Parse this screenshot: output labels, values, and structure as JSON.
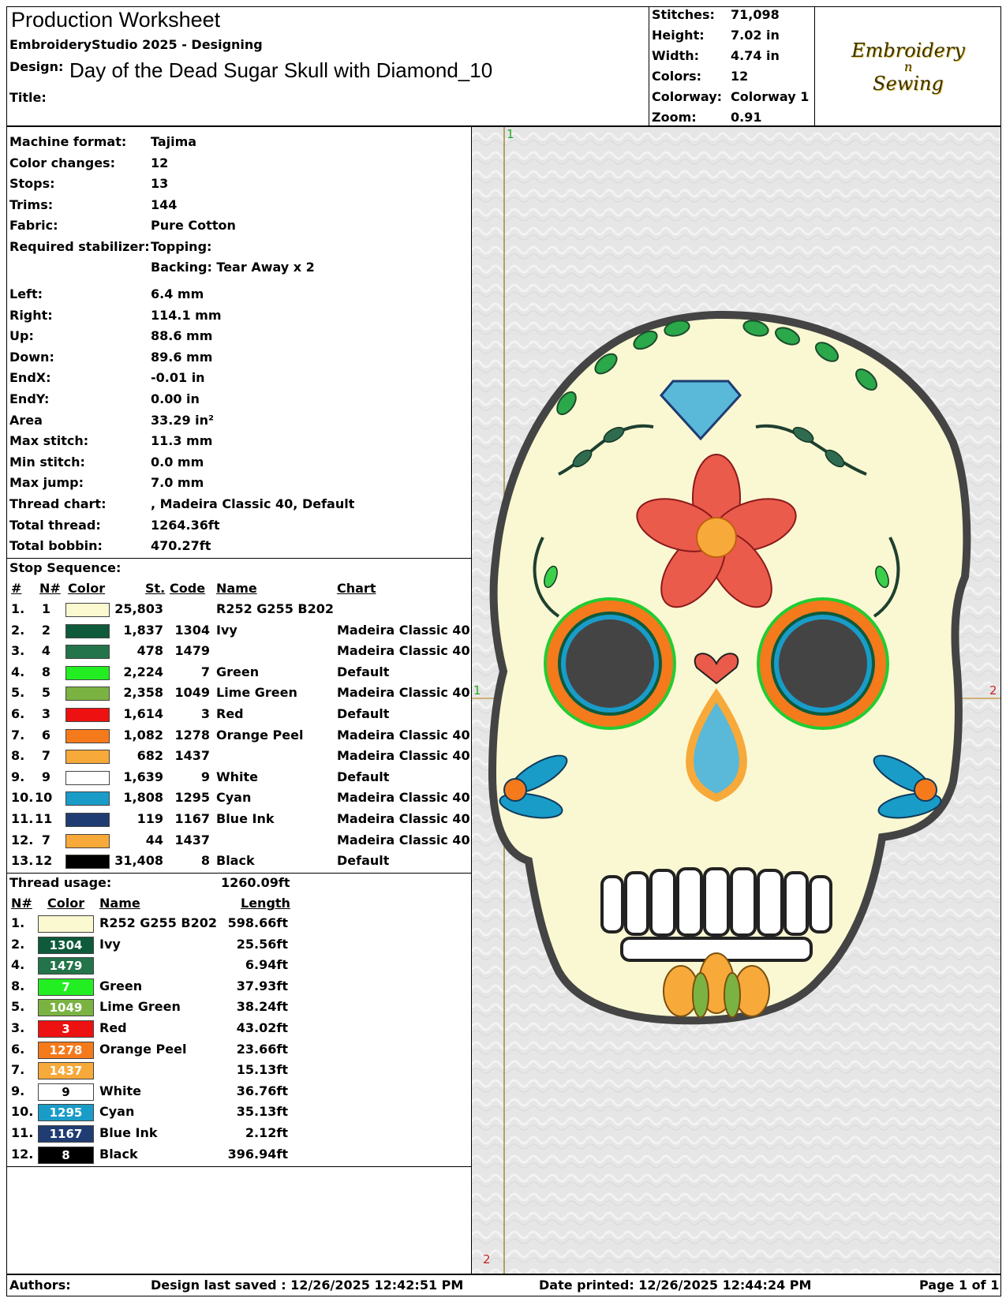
{
  "header": {
    "title": "Production Worksheet",
    "app": "EmbroideryStudio 2025 - Designing",
    "design_label": "Design:",
    "design_name": "Day of the Dead Sugar Skull with Diamond_10",
    "title_label": "Title:"
  },
  "stats": [
    {
      "label": "Stitches:",
      "value": "71,098"
    },
    {
      "label": "Height:",
      "value": "7.02 in"
    },
    {
      "label": "Width:",
      "value": "4.74 in"
    },
    {
      "label": "Colors:",
      "value": "12"
    },
    {
      "label": "Colorway:",
      "value": "Colorway 1"
    },
    {
      "label": "Zoom:",
      "value": "0.91"
    }
  ],
  "logo": {
    "line1": "Embroidery",
    "line2": "n",
    "line3": "Sewing"
  },
  "details": [
    {
      "label": "Machine format:",
      "value": "Tajima"
    },
    {
      "label": "Color changes:",
      "value": "12"
    },
    {
      "label": "Stops:",
      "value": "13"
    },
    {
      "label": "Trims:",
      "value": "144"
    },
    {
      "label": "Fabric:",
      "value": "Pure Cotton"
    },
    {
      "label": "Required stabilizer:",
      "value": "Topping:"
    },
    {
      "label": "",
      "value": "Backing: Tear Away x 2"
    }
  ],
  "details2": [
    {
      "label": "Left:",
      "value": "6.4 mm"
    },
    {
      "label": "Right:",
      "value": "114.1 mm"
    },
    {
      "label": "Up:",
      "value": "88.6 mm"
    },
    {
      "label": "Down:",
      "value": "89.6 mm"
    },
    {
      "label": "EndX:",
      "value": "-0.01 in"
    },
    {
      "label": "EndY:",
      "value": "0.00 in"
    },
    {
      "label": "Area",
      "value": " 33.29 in²"
    },
    {
      "label": "Max stitch:",
      "value": "11.3 mm"
    },
    {
      "label": "Min stitch:",
      "value": "0.0 mm"
    },
    {
      "label": "Max jump:",
      "value": "7.0 mm"
    },
    {
      "label": "Thread chart:",
      "value": ", Madeira Classic 40, Default"
    },
    {
      "label": "Total thread:",
      "value": "1264.36ft"
    },
    {
      "label": "Total bobbin:",
      "value": "470.27ft"
    }
  ],
  "stop_sequence": {
    "title": "Stop Sequence:",
    "headers": {
      "num": "#",
      "n": "N#",
      "color": "Color",
      "st": "St.",
      "code": "Code",
      "name": "Name",
      "chart": "Chart"
    },
    "rows": [
      {
        "num": "1.",
        "n": "1",
        "color": "#FBF9D0",
        "st": "25,803",
        "code": "",
        "name": "R252 G255 B202",
        "chart": ""
      },
      {
        "num": "2.",
        "n": "2",
        "color": "#0E5A3A",
        "st": "1,837",
        "code": "1304",
        "name": "Ivy",
        "chart": "Madeira Classic 40"
      },
      {
        "num": "3.",
        "n": "4",
        "color": "#23744A",
        "st": "478",
        "code": "1479",
        "name": "",
        "chart": "Madeira Classic 40"
      },
      {
        "num": "4.",
        "n": "8",
        "color": "#22EE22",
        "st": "2,224",
        "code": "7",
        "name": "Green",
        "chart": "Default"
      },
      {
        "num": "5.",
        "n": "5",
        "color": "#7BB342",
        "st": "2,358",
        "code": "1049",
        "name": "Lime Green",
        "chart": "Madeira Classic 40"
      },
      {
        "num": "6.",
        "n": "3",
        "color": "#EE1111",
        "st": "1,614",
        "code": "3",
        "name": "Red",
        "chart": "Default"
      },
      {
        "num": "7.",
        "n": "6",
        "color": "#F57A1C",
        "st": "1,082",
        "code": "1278",
        "name": "Orange Peel",
        "chart": "Madeira Classic 40"
      },
      {
        "num": "8.",
        "n": "7",
        "color": "#F7A93A",
        "st": "682",
        "code": "1437",
        "name": "",
        "chart": "Madeira Classic 40"
      },
      {
        "num": "9.",
        "n": "9",
        "color": "#FFFFFF",
        "st": "1,639",
        "code": "9",
        "name": "White",
        "chart": "Default"
      },
      {
        "num": "10.",
        "n": "10",
        "color": "#1A9CC9",
        "st": "1,808",
        "code": "1295",
        "name": "Cyan",
        "chart": "Madeira Classic 40"
      },
      {
        "num": "11.",
        "n": "11",
        "color": "#1F3D72",
        "st": "119",
        "code": "1167",
        "name": "Blue Ink",
        "chart": "Madeira Classic 40"
      },
      {
        "num": "12.",
        "n": "7",
        "color": "#F7A93A",
        "st": "44",
        "code": "1437",
        "name": "",
        "chart": "Madeira Classic 40"
      },
      {
        "num": "13.",
        "n": "12",
        "color": "#000000",
        "st": "31,408",
        "code": "8",
        "name": "Black",
        "chart": "Default"
      }
    ]
  },
  "thread_usage": {
    "title": "Thread usage:",
    "total": "1260.09ft",
    "headers": {
      "n": "N#",
      "color": "Color",
      "name": "Name",
      "length": "Length"
    },
    "rows": [
      {
        "n": "1.",
        "color": "#FBF9D0",
        "code": "",
        "name": "R252 G255 B202",
        "length": "598.66ft"
      },
      {
        "n": "2.",
        "color": "#0E5A3A",
        "code": "1304",
        "name": "Ivy",
        "length": "25.56ft"
      },
      {
        "n": "4.",
        "color": "#23744A",
        "code": "1479",
        "name": "",
        "length": "6.94ft"
      },
      {
        "n": "8.",
        "color": "#22EE22",
        "code": "7",
        "name": "Green",
        "length": "37.93ft"
      },
      {
        "n": "5.",
        "color": "#7BB342",
        "code": "1049",
        "name": "Lime Green",
        "length": "38.24ft"
      },
      {
        "n": "3.",
        "color": "#EE1111",
        "code": "3",
        "name": "Red",
        "length": "43.02ft"
      },
      {
        "n": "6.",
        "color": "#F57A1C",
        "code": "1278",
        "name": "Orange Peel",
        "length": "23.66ft"
      },
      {
        "n": "7.",
        "color": "#F7A93A",
        "code": "1437",
        "name": "",
        "length": "15.13ft"
      },
      {
        "n": "9.",
        "color": "#FFFFFF",
        "code": "9",
        "name": "White",
        "length": "36.76ft"
      },
      {
        "n": "10.",
        "color": "#1A9CC9",
        "code": "1295",
        "name": "Cyan",
        "length": "35.13ft"
      },
      {
        "n": "11.",
        "color": "#1F3D72",
        "code": "1167",
        "name": "Blue Ink",
        "length": "2.12ft"
      },
      {
        "n": "12.",
        "color": "#000000",
        "code": "8",
        "name": "Black",
        "length": "396.94ft"
      }
    ]
  },
  "preview": {
    "marker_top": "1",
    "marker_bottom": "2",
    "marker_left": "1",
    "marker_right": "2"
  },
  "footer": {
    "authors": "Authors:",
    "saved": "Design last saved : 12/26/2025 12:42:51 PM",
    "printed": "Date printed: 12/26/2025 12:44:24 PM",
    "page": "Page 1 of 1"
  }
}
